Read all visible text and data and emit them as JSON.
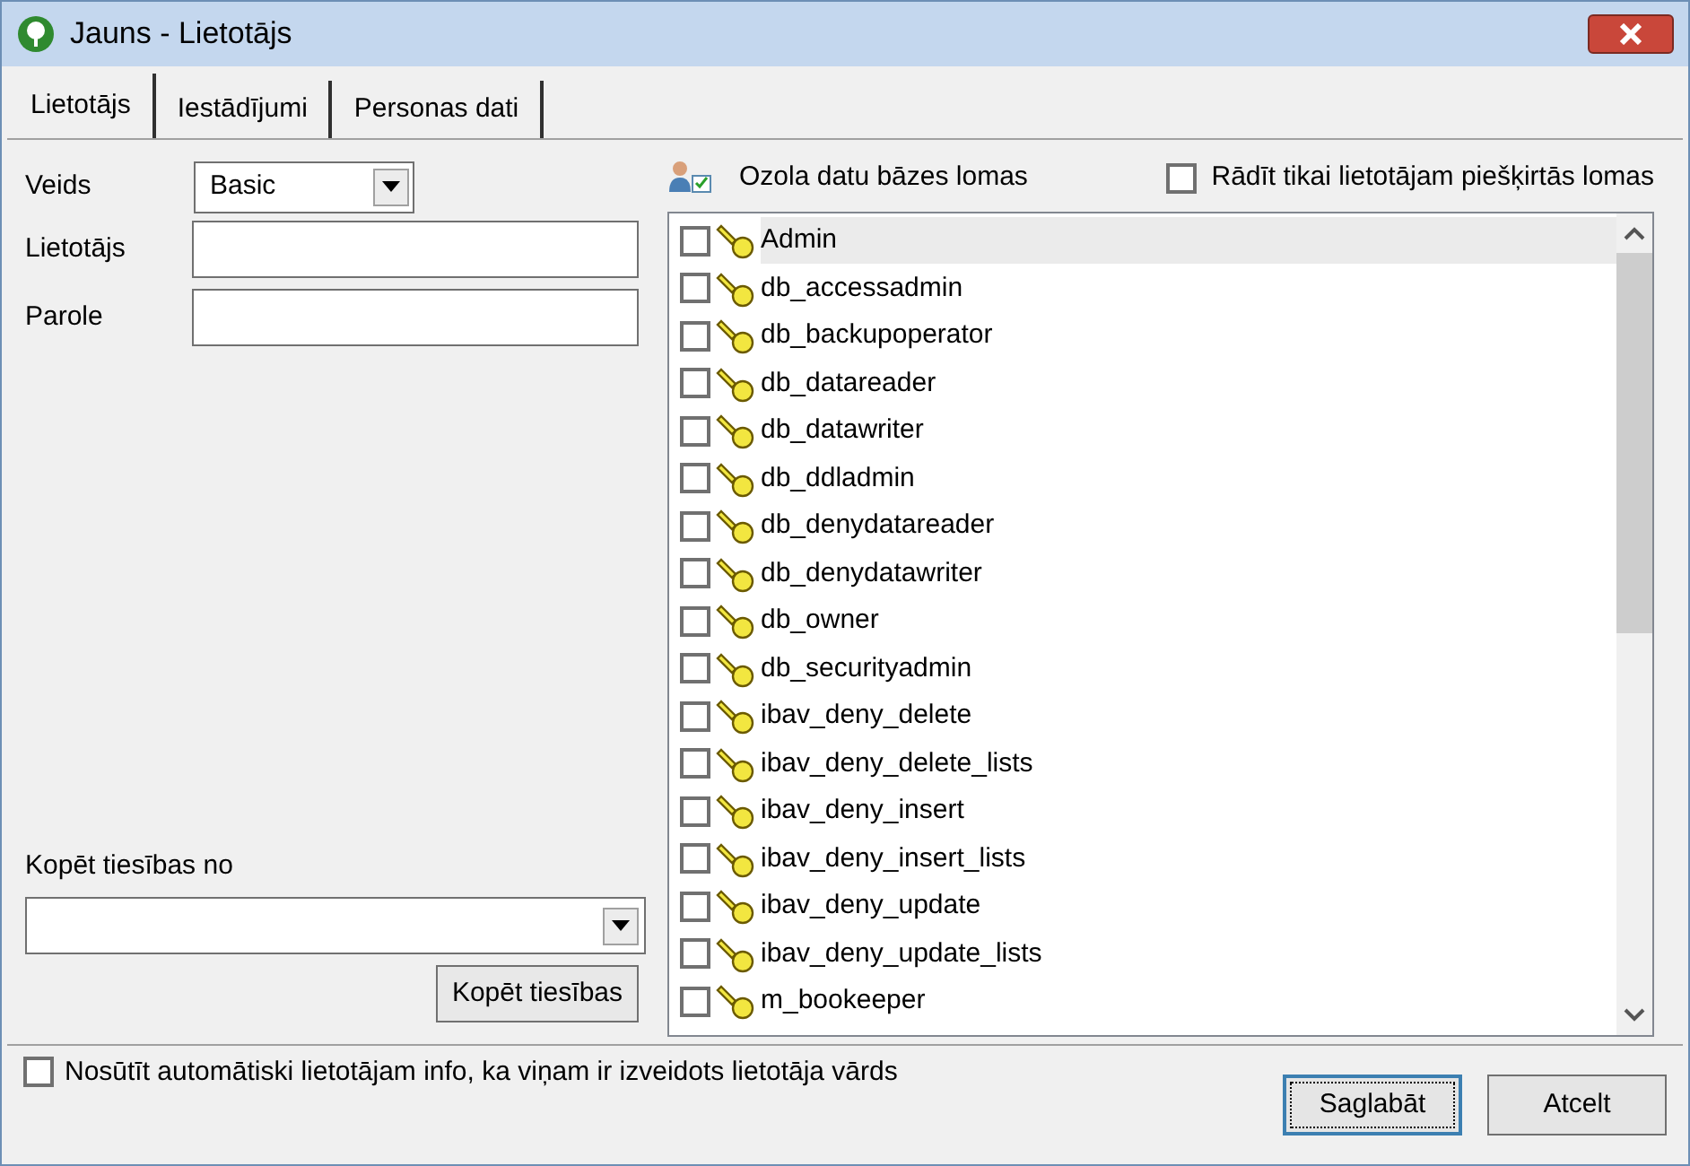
{
  "window": {
    "title": "Jauns - Lietotājs"
  },
  "tabs": [
    {
      "label": "Lietotājs",
      "selected": true
    },
    {
      "label": "Iestādījumi",
      "selected": false
    },
    {
      "label": "Personas dati",
      "selected": false
    }
  ],
  "form": {
    "type_label": "Veids",
    "type_value": "Basic",
    "user_label": "Lietotājs",
    "password_label": "Parole",
    "copy_label": "Kopēt tiesības no",
    "copy_button": "Kopēt tiesības"
  },
  "roles": {
    "title": "Ozola datu bāzes lomas",
    "filter": {
      "label": "Rādīt tikai lietotājam piešķirtās lomas",
      "checked": false
    },
    "items": [
      {
        "name": "Admin",
        "checked": false,
        "selected": true
      },
      {
        "name": "db_accessadmin",
        "checked": false,
        "selected": false
      },
      {
        "name": "db_backupoperator",
        "checked": false,
        "selected": false
      },
      {
        "name": "db_datareader",
        "checked": false,
        "selected": false
      },
      {
        "name": "db_datawriter",
        "checked": false,
        "selected": false
      },
      {
        "name": "db_ddladmin",
        "checked": false,
        "selected": false
      },
      {
        "name": "db_denydatareader",
        "checked": false,
        "selected": false
      },
      {
        "name": "db_denydatawriter",
        "checked": false,
        "selected": false
      },
      {
        "name": "db_owner",
        "checked": false,
        "selected": false
      },
      {
        "name": "db_securityadmin",
        "checked": false,
        "selected": false
      },
      {
        "name": "ibav_deny_delete",
        "checked": false,
        "selected": false
      },
      {
        "name": "ibav_deny_delete_lists",
        "checked": false,
        "selected": false
      },
      {
        "name": "ibav_deny_insert",
        "checked": false,
        "selected": false
      },
      {
        "name": "ibav_deny_insert_lists",
        "checked": false,
        "selected": false
      },
      {
        "name": "ibav_deny_update",
        "checked": false,
        "selected": false
      },
      {
        "name": "ibav_deny_update_lists",
        "checked": false,
        "selected": false
      },
      {
        "name": "m_bookeeper",
        "checked": false,
        "selected": false
      }
    ]
  },
  "notify": {
    "label": "Nosūtīt automātiski lietotājam info, ka viņam ir izveidots lietotāja vārds",
    "checked": false
  },
  "buttons": [
    {
      "label": "Saglabāt",
      "default": true
    },
    {
      "label": "Atcelt",
      "default": false
    }
  ]
}
